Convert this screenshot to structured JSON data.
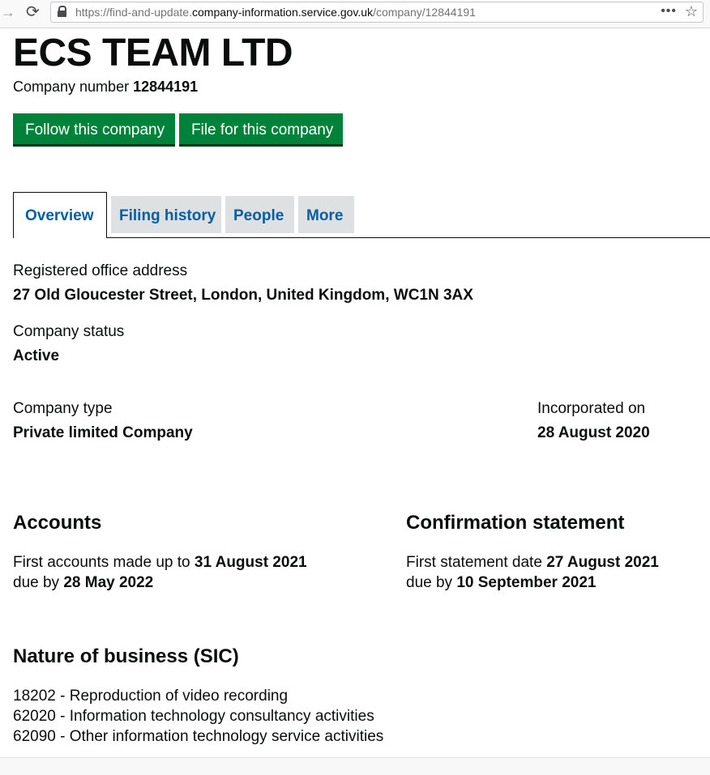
{
  "browser": {
    "url_prefix": "https://find-and-update.",
    "url_host": "company-information.service.gov.uk",
    "url_path": "/company/12844191"
  },
  "company": {
    "name": "ECS TEAM LTD",
    "number_label": "Company number",
    "number": "12844191"
  },
  "buttons": {
    "follow": "Follow this company",
    "file": "File for this company"
  },
  "tabs": [
    "Overview",
    "Filing history",
    "People",
    "More"
  ],
  "overview": {
    "address_label": "Registered office address",
    "address": "27 Old Gloucester Street, London, United Kingdom, WC1N 3AX",
    "status_label": "Company status",
    "status": "Active",
    "type_label": "Company type",
    "type": "Private limited Company",
    "incorporated_label": "Incorporated on",
    "incorporated": "28 August 2020"
  },
  "accounts": {
    "heading": "Accounts",
    "first_prefix": "First accounts made up to",
    "first_date": "31 August 2021",
    "due_prefix": "due by",
    "due_date": "28 May 2022"
  },
  "confirmation": {
    "heading": "Confirmation statement",
    "first_prefix": "First statement date",
    "first_date": "27 August 2021",
    "due_prefix": "due by",
    "due_date": "10 September 2021"
  },
  "sic": {
    "heading": "Nature of business (SIC)",
    "items": [
      "18202 - Reproduction of video recording",
      "62020 - Information technology consultancy activities",
      "62090 - Other information technology service activities"
    ]
  },
  "colors": {
    "button_green": "#00823b",
    "link_blue": "#005ea5",
    "tab_grey": "#dee0e2"
  }
}
